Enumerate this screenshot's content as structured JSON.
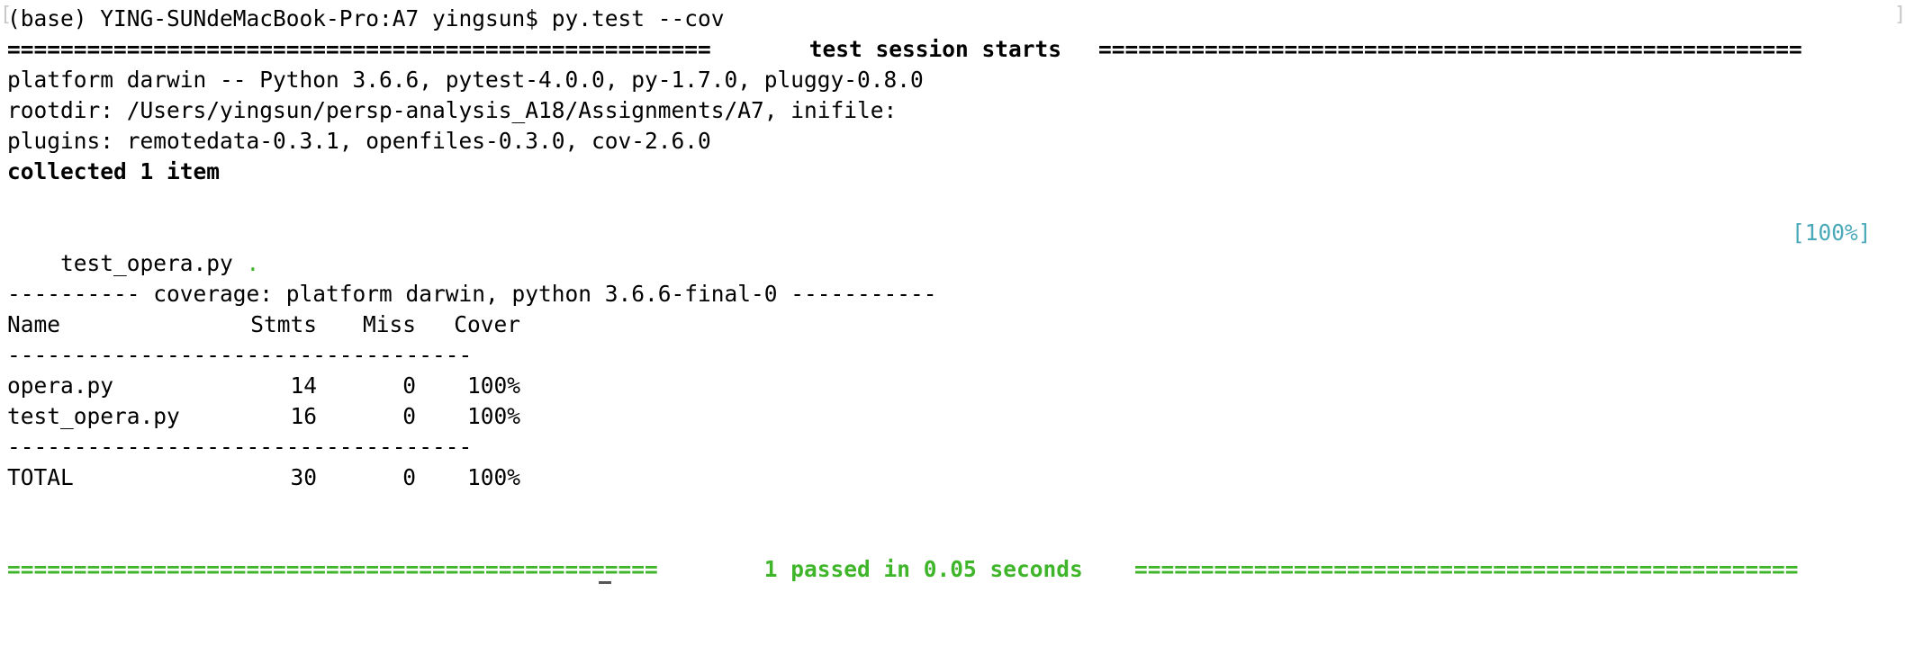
{
  "prompt_line": "(base) YING-SUNdeMacBook-Pro:A7 yingsun$ py.test --cov",
  "session": {
    "start_rule": "=====================================================",
    "start_title": " test session starts ",
    "start_rule_right": "=====================================================",
    "platform": "platform darwin -- Python 3.6.6, pytest-4.0.0, py-1.7.0, pluggy-0.8.0",
    "rootdir": "rootdir: /Users/yingsun/persp-analysis_A18/Assignments/A7, inifile:",
    "plugins": "plugins: remotedata-0.3.1, openfiles-0.3.0, cov-2.6.0",
    "collected": "collected 1 item"
  },
  "test_result": {
    "file": "test_opera.py",
    "dot": ".",
    "progress": "[100%]"
  },
  "coverage": {
    "header": "---------- coverage: platform darwin, python 3.6.6-final-0 -----------",
    "columns": [
      "Name",
      "Stmts",
      "Miss",
      "Cover"
    ],
    "separator": "-----------------------------------",
    "rows": [
      {
        "name": "opera.py",
        "stmts": "14",
        "miss": "0",
        "cover": "100%"
      },
      {
        "name": "test_opera.py",
        "stmts": "16",
        "miss": "0",
        "cover": "100%"
      }
    ],
    "total": {
      "name": "TOTAL",
      "stmts": "30",
      "miss": "0",
      "cover": "100%"
    }
  },
  "summary": {
    "rule_left": "=================================================",
    "text": " 1 passed in 0.05 seconds ",
    "rule_right": "=================================================="
  },
  "colors": {
    "pass_green": "#3fb52a",
    "progress_cyan": "#49a9b9",
    "text": "#000000",
    "background": "#ffffff"
  }
}
